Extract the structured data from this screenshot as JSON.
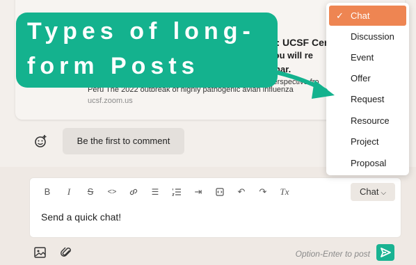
{
  "link_preview": {
    "title": "r: UCSF Cen",
    "bold_line2": "registering, you will re",
    "bold_line3": "ning the webinar.",
    "desc_line1": "e: A One Health Perspective fro",
    "desc_line2": "Peru The 2022 outbreak of highly pathogenic avian influenza",
    "domain": "ucsf.zoom.us"
  },
  "comments": {
    "first_comment_label": "Be the first to comment",
    "react_icon": "smiley-plus-icon"
  },
  "editor": {
    "toolbar": [
      {
        "icon": "bold-icon",
        "glyph": "B"
      },
      {
        "icon": "italic-icon",
        "glyph": "I"
      },
      {
        "icon": "strikethrough-icon",
        "glyph": "S"
      },
      {
        "icon": "code-icon",
        "glyph": "<>"
      },
      {
        "icon": "link-icon",
        "glyph": ""
      },
      {
        "icon": "bulleted-list-icon",
        "glyph": "☰"
      },
      {
        "icon": "numbered-list-icon",
        "glyph": ""
      },
      {
        "icon": "indent-icon",
        "glyph": "⇥"
      },
      {
        "icon": "embed-icon",
        "glyph": ""
      },
      {
        "icon": "undo-icon",
        "glyph": "↶"
      },
      {
        "icon": "redo-icon",
        "glyph": "↷"
      },
      {
        "icon": "clear-format-icon",
        "glyph": "Tx"
      }
    ],
    "post_type_select": "Chat",
    "placeholder": "Send a quick chat!",
    "post_hint": "Option-Enter to post"
  },
  "post_type_menu": {
    "items": [
      {
        "label": "Chat",
        "selected": true
      },
      {
        "label": "Discussion",
        "selected": false
      },
      {
        "label": "Event",
        "selected": false
      },
      {
        "label": "Offer",
        "selected": false
      },
      {
        "label": "Request",
        "selected": false
      },
      {
        "label": "Resource",
        "selected": false
      },
      {
        "label": "Project",
        "selected": false
      },
      {
        "label": "Proposal",
        "selected": false
      }
    ]
  },
  "overlay": {
    "line1": "Types of long-",
    "line2": "form Posts"
  },
  "colors": {
    "accent_orange": "#ee8552",
    "accent_teal": "#14b28e",
    "send_button": "#19b392"
  }
}
